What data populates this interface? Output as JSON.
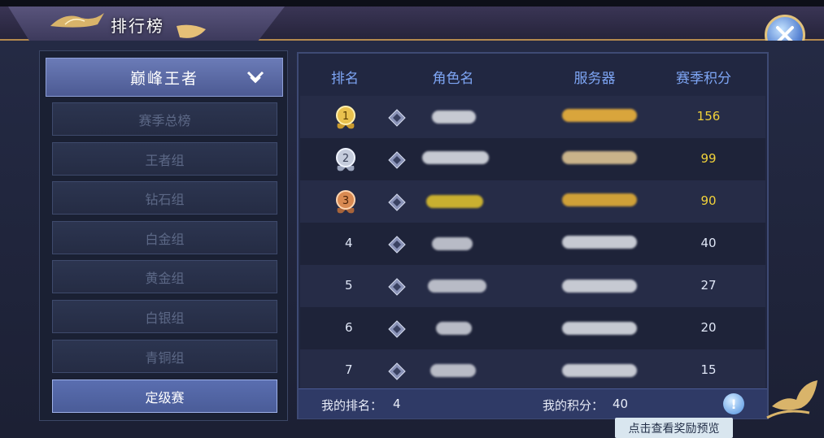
{
  "window": {
    "title": "排行榜"
  },
  "category_selector": {
    "label": "巅峰王者"
  },
  "categories": [
    {
      "label": "赛季总榜",
      "selected": false
    },
    {
      "label": "王者组",
      "selected": false
    },
    {
      "label": "钻石组",
      "selected": false
    },
    {
      "label": "白金组",
      "selected": false
    },
    {
      "label": "黄金组",
      "selected": false
    },
    {
      "label": "白银组",
      "selected": false
    },
    {
      "label": "青铜组",
      "selected": false
    },
    {
      "label": "定级赛",
      "selected": true
    }
  ],
  "table": {
    "headers": {
      "rank": "排名",
      "name": "角色名",
      "server": "服务器",
      "score": "赛季积分"
    },
    "rows": [
      {
        "rank": "1",
        "medal": "gold",
        "score": "156"
      },
      {
        "rank": "2",
        "medal": "silver",
        "score": "99"
      },
      {
        "rank": "3",
        "medal": "bronze",
        "score": "90"
      },
      {
        "rank": "4",
        "score": "40"
      },
      {
        "rank": "5",
        "score": "27"
      },
      {
        "rank": "6",
        "score": "20"
      },
      {
        "rank": "7",
        "score": "15"
      }
    ]
  },
  "footer": {
    "my_rank_label": "我的排名：",
    "my_rank_value": "4",
    "my_score_label": "我的积分：",
    "my_score_value": "40"
  },
  "tooltip": {
    "text": "点击查看奖励预览"
  },
  "colors": {
    "header_accent": "#7ea6f5",
    "top3_score": "#f1d23a",
    "normal_score": "#dfe6f6",
    "selected_category": "#5a6eb0"
  }
}
